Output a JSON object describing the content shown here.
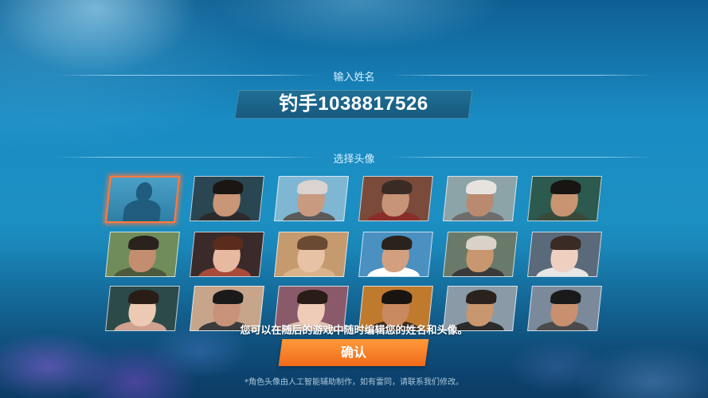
{
  "name_section": {
    "label": "输入姓名",
    "player_name": "钓手1038817526"
  },
  "avatar_section": {
    "label": "选择头像",
    "selected_index": 0,
    "avatars": [
      {
        "id": "silhouette",
        "bg": "#3c8db5",
        "skin": "#1f5c7d",
        "hair": "#1f5c7d",
        "cloth": "#1f5c7d"
      },
      {
        "id": "man-1",
        "bg": "#2a4652",
        "skin": "#c99677",
        "hair": "#1b1613",
        "cloth": "#2b2b2b"
      },
      {
        "id": "elder-man-1",
        "bg": "#7fb7d3",
        "skin": "#c89a80",
        "hair": "#d9d4cf",
        "cloth": "#5a5a5a"
      },
      {
        "id": "elder-woman-1",
        "bg": "#7a4b3b",
        "skin": "#c89478",
        "hair": "#3a2b25",
        "cloth": "#8a2e2a"
      },
      {
        "id": "elder-man-2",
        "bg": "#8ca3a8",
        "skin": "#b98a70",
        "hair": "#e6e3de",
        "cloth": "#6d6d6d"
      },
      {
        "id": "man-2",
        "bg": "#2c5a4e",
        "skin": "#c99472",
        "hair": "#181512",
        "cloth": "#3a4a3a"
      },
      {
        "id": "man-3",
        "bg": "#6f8c5a",
        "skin": "#c28e6f",
        "hair": "#2a221c",
        "cloth": "#4b5a3c"
      },
      {
        "id": "woman-1",
        "bg": "#3a2a2a",
        "skin": "#e6b9a0",
        "hair": "#5a2c1e",
        "cloth": "#a84b3a"
      },
      {
        "id": "woman-2",
        "bg": "#c49a6e",
        "skin": "#e8c2a4",
        "hair": "#6a4a32",
        "cloth": "#d9b38a"
      },
      {
        "id": "man-4",
        "bg": "#4a90c0",
        "skin": "#d2a07f",
        "hair": "#2a221c",
        "cloth": "#ffffff"
      },
      {
        "id": "man-5",
        "bg": "#6a7a6a",
        "skin": "#c8966f",
        "hair": "#d8d2c8",
        "cloth": "#3a3a3a"
      },
      {
        "id": "woman-3",
        "bg": "#5a6a7a",
        "skin": "#efd0c0",
        "hair": "#3a2b25",
        "cloth": "#e6e6e6"
      },
      {
        "id": "woman-4",
        "bg": "#2c4a4a",
        "skin": "#ecc9b2",
        "hair": "#2a1c16",
        "cloth": "#d0a090"
      },
      {
        "id": "elder-man-3",
        "bg": "#c7a58a",
        "skin": "#c89278",
        "hair": "#1a1a1a",
        "cloth": "#3b3b3b"
      },
      {
        "id": "woman-5",
        "bg": "#8a5a6a",
        "skin": "#efccb8",
        "hair": "#2a1c16",
        "cloth": "#e0c0b0"
      },
      {
        "id": "man-6",
        "bg": "#c07a2e",
        "skin": "#c98a60",
        "hair": "#1a1410",
        "cloth": "#3a2a20"
      },
      {
        "id": "man-7",
        "bg": "#8a9aa6",
        "skin": "#c8966f",
        "hair": "#2a221c",
        "cloth": "#2a2a2a"
      },
      {
        "id": "man-8",
        "bg": "#7a8a9a",
        "skin": "#c99070",
        "hair": "#1a1a1a",
        "cloth": "#4a4a4a"
      }
    ]
  },
  "hint_text": "您可以在随后的游戏中随时编辑您的姓名和头像。",
  "confirm_button": {
    "label": "确认",
    "color": "#f47a24"
  },
  "disclaimer": "*角色头像由人工智能辅助制作，如有雷同，请联系我们修改。"
}
